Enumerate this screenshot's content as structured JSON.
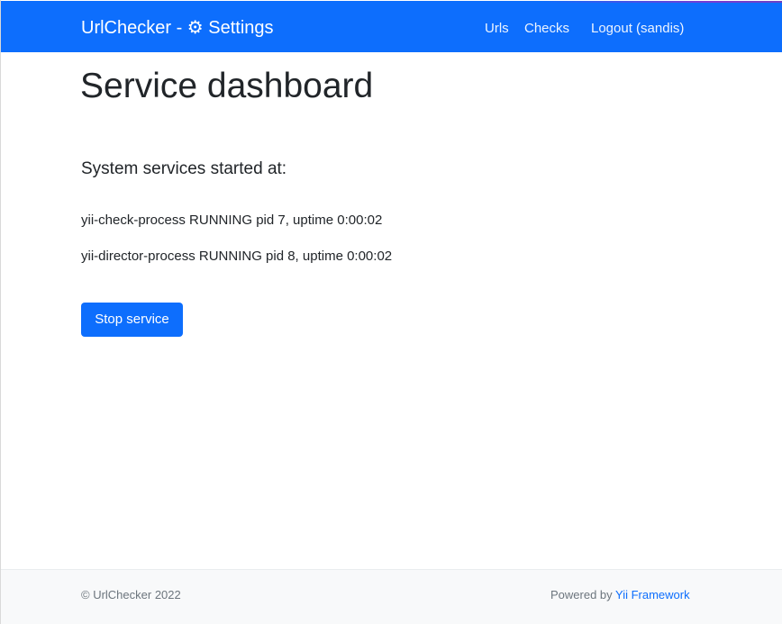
{
  "navbar": {
    "brand": "UrlChecker - ⚙ Settings",
    "links": [
      {
        "label": "Urls"
      },
      {
        "label": "Checks"
      },
      {
        "label": "Logout (sandis)"
      }
    ],
    "colors": {
      "background": "#0d6efd",
      "text": "#ffffff"
    }
  },
  "main": {
    "title": "Service dashboard",
    "section_title": "System services started at:",
    "services": [
      "yii-check-process RUNNING pid 7, uptime 0:00:02",
      "yii-director-process RUNNING pid 8, uptime 0:00:02"
    ],
    "stop_button_label": "Stop service"
  },
  "footer": {
    "copyright": "© UrlChecker 2022",
    "powered_prefix": "Powered by ",
    "powered_link": "Yii Framework",
    "colors": {
      "background": "#f8f9fa",
      "text": "#6c757d",
      "link": "#0d6efd"
    }
  }
}
